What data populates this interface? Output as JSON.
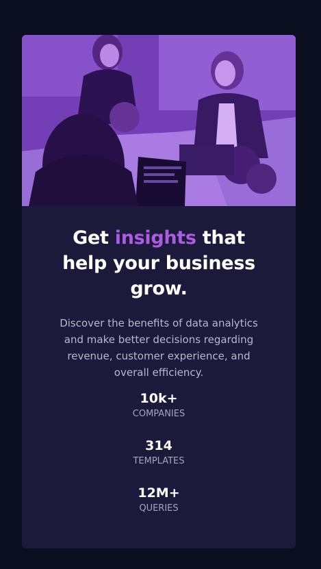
{
  "hero_image": {
    "alt": "",
    "tint_color": "#aa5af5"
  },
  "headline": {
    "before": "Get ",
    "accent": "insights",
    "after": " that help your business grow."
  },
  "description": "Discover the benefits of data analytics and make better decisions regarding revenue, customer experience, and overall efficiency.",
  "stats": [
    {
      "value": "10k+",
      "label": "COMPANIES"
    },
    {
      "value": "314",
      "label": "TEMPLATES"
    },
    {
      "value": "12M+",
      "label": "QUERIES"
    }
  ],
  "colors": {
    "page_bg": "#0b0e1f",
    "card_bg": "#1b1a3b",
    "accent": "#ab5ce1",
    "text": "#ffffff",
    "muted": "#b9b8cc"
  }
}
